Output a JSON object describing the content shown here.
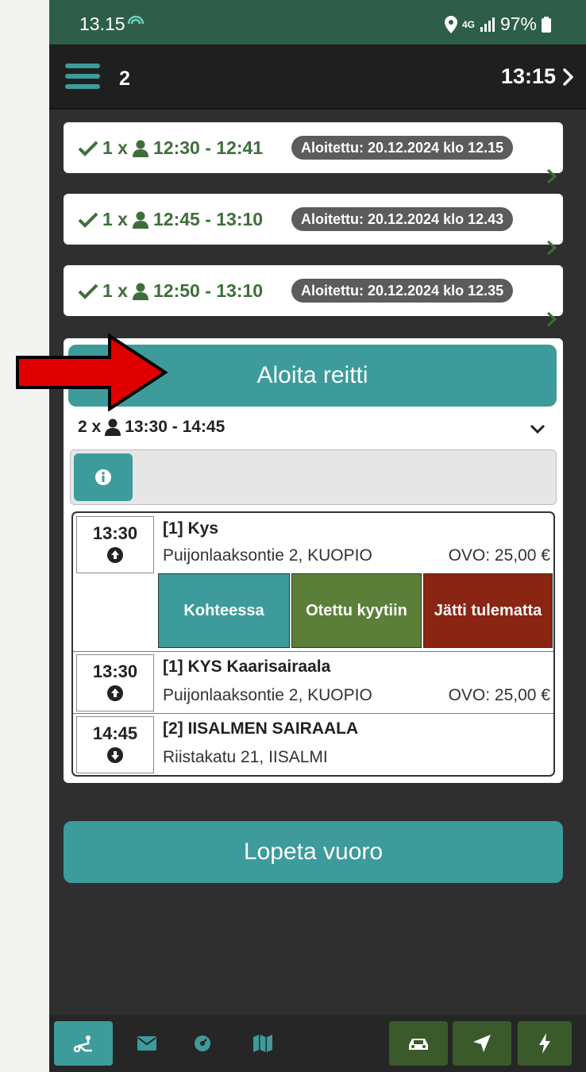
{
  "status_bar": {
    "time": "13.15",
    "network": "4G",
    "battery": "97%"
  },
  "app_bar": {
    "count": "2",
    "time": "13:15"
  },
  "trips": [
    {
      "count": "1 x",
      "time_range": "12:30 - 12:41",
      "badge": "Aloitettu: 20.12.2024 klo 12.15"
    },
    {
      "count": "1 x",
      "time_range": "12:45 - 13:10",
      "badge": "Aloitettu: 20.12.2024 klo 12.43"
    },
    {
      "count": "1 x",
      "time_range": "12:50 - 13:10",
      "badge": "Aloitettu: 20.12.2024 klo 12.35"
    }
  ],
  "route": {
    "start_label": "Aloita reitti",
    "count": "2 x",
    "time_range": "13:30 - 14:45",
    "stops": [
      {
        "time": "13:30",
        "direction": "up",
        "name": "[1] Kys",
        "address": "Puijonlaaksontie 2, KUOPIO",
        "fare": "OVO: 25,00 €"
      },
      {
        "time": "13:30",
        "direction": "up",
        "name": "[1] KYS Kaarisairaala",
        "address": "Puijonlaaksontie 2, KUOPIO",
        "fare": "OVO: 25,00 €"
      },
      {
        "time": "14:45",
        "direction": "down",
        "name": "[2] IISALMEN SAIRAALA",
        "address": "Riistakatu 21, IISALMI",
        "fare": ""
      }
    ],
    "actions": [
      {
        "label": "Kohteessa",
        "color": "#3d9b9b"
      },
      {
        "label": "Otettu kyytiin",
        "color": "#5b7f38"
      },
      {
        "label": "Jätti tulematta",
        "color": "#8a2413"
      }
    ]
  },
  "end_shift_label": "Lopeta vuoro",
  "colors": {
    "accent": "#3d9b9b",
    "header": "#2e5e4a",
    "success": "#3f6e3a",
    "arrow": "#e00000"
  }
}
